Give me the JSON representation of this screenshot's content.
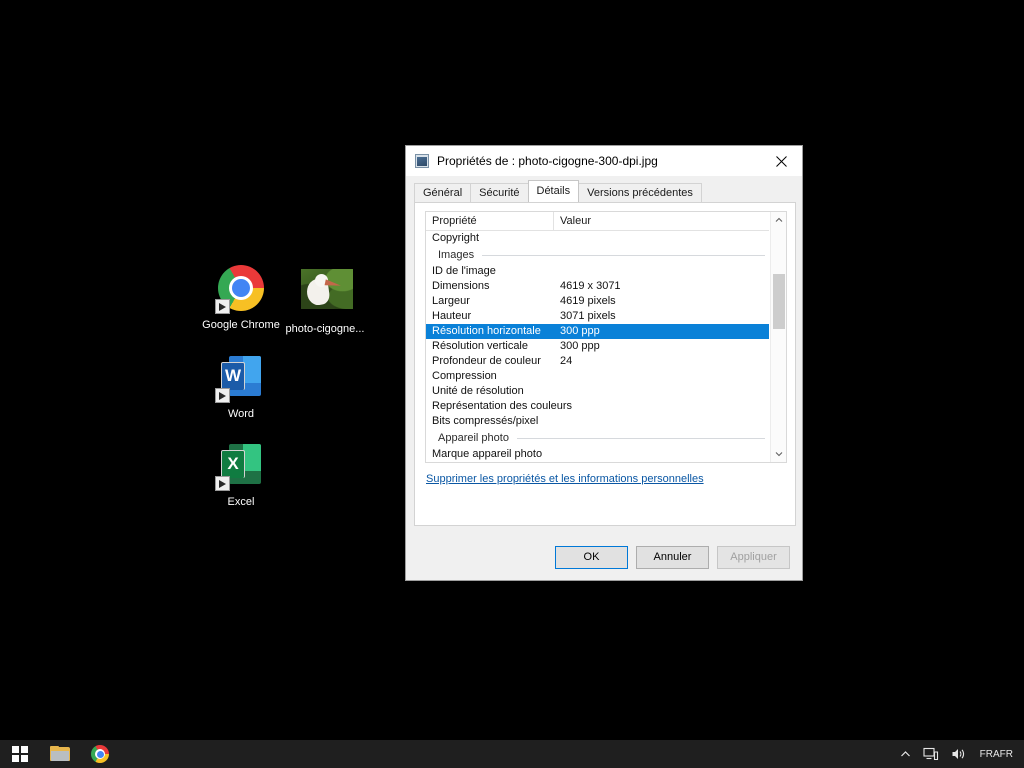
{
  "desktop": {
    "icons": [
      {
        "label": "Google Chrome",
        "icon": "chrome-icon"
      },
      {
        "label": "photo-cigogne...",
        "icon": "image-thumbnail-icon"
      },
      {
        "label": "Word",
        "icon": "word-icon"
      },
      {
        "label": "Excel",
        "icon": "excel-icon"
      }
    ]
  },
  "taskbar": {
    "start": "start-button",
    "items": [
      {
        "name": "file-explorer",
        "icon": "folder-icon"
      },
      {
        "name": "google-chrome",
        "icon": "chrome-icon"
      }
    ],
    "tray": {
      "chevron": "chevron-up-icon",
      "network": "network-icon",
      "volume": "volume-icon",
      "language_primary": "FRA",
      "language_secondary": "FR"
    }
  },
  "dialog": {
    "title": "Propriétés de : photo-cigogne-300-dpi.jpg",
    "title_icon": "image-file-icon",
    "close_label": "✕",
    "tabs": [
      {
        "label": "Général",
        "active": false
      },
      {
        "label": "Sécurité",
        "active": false
      },
      {
        "label": "Détails",
        "active": true
      },
      {
        "label": "Versions précédentes",
        "active": false
      }
    ],
    "table": {
      "headers": {
        "property": "Propriété",
        "value": "Valeur"
      },
      "rows": [
        {
          "type": "row",
          "property": "Copyright",
          "value": "",
          "selected": false
        },
        {
          "type": "group",
          "property": "Images"
        },
        {
          "type": "row",
          "property": "ID de l'image",
          "value": "",
          "selected": false
        },
        {
          "type": "row",
          "property": "Dimensions",
          "value": "4619 x 3071",
          "selected": false
        },
        {
          "type": "row",
          "property": "Largeur",
          "value": "4619 pixels",
          "selected": false
        },
        {
          "type": "row",
          "property": "Hauteur",
          "value": "3071 pixels",
          "selected": false
        },
        {
          "type": "row",
          "property": "Résolution horizontale",
          "value": "300 ppp",
          "selected": true
        },
        {
          "type": "row",
          "property": "Résolution verticale",
          "value": "300 ppp",
          "selected": false
        },
        {
          "type": "row",
          "property": "Profondeur de couleur",
          "value": "24",
          "selected": false
        },
        {
          "type": "row",
          "property": "Compression",
          "value": "",
          "selected": false
        },
        {
          "type": "row",
          "property": "Unité de résolution",
          "value": "",
          "selected": false
        },
        {
          "type": "row",
          "property": "Représentation des couleurs",
          "value": "",
          "selected": false
        },
        {
          "type": "row",
          "property": "Bits compressés/pixel",
          "value": "",
          "selected": false
        },
        {
          "type": "group",
          "property": "Appareil photo"
        },
        {
          "type": "row",
          "property": "Marque appareil photo",
          "value": "",
          "selected": false
        }
      ]
    },
    "privacy_link": "Supprimer les propriétés et les informations personnelles",
    "buttons": {
      "ok": "OK",
      "cancel": "Annuler",
      "apply": "Appliquer"
    }
  },
  "colors": {
    "selection": "#0a81d8",
    "link": "#0a57a4",
    "accent": "#0078d7",
    "desktop_bg": "#000000",
    "taskbar_bg": "#1f1f1f"
  }
}
